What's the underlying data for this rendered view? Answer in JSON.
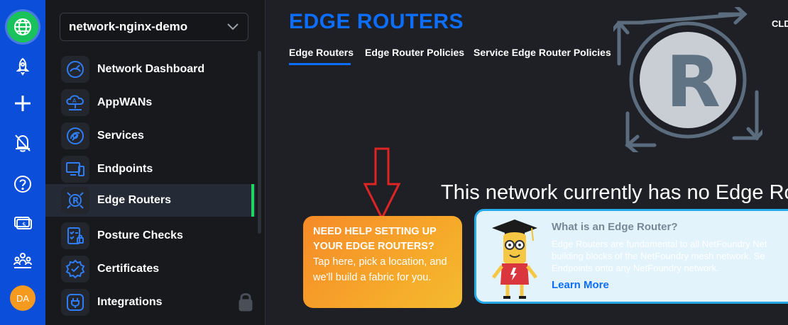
{
  "rail": {
    "avatar_initials": "DA",
    "icons": [
      "network-icon",
      "rocket-icon",
      "plus-icon",
      "alarm-bell-icon",
      "help-icon",
      "billing-icon",
      "organization-icon"
    ]
  },
  "sidebar": {
    "network_name": "network-nginx-demo",
    "items": [
      {
        "label": "Network Dashboard",
        "icon": "dashboard-gauge-icon"
      },
      {
        "label": "AppWANs",
        "icon": "appwan-cloud-icon"
      },
      {
        "label": "Services",
        "icon": "services-icon"
      },
      {
        "label": "Endpoints",
        "icon": "endpoints-icon"
      },
      {
        "label": "Edge Routers",
        "icon": "edge-router-icon",
        "active": true
      },
      {
        "label": "Posture Checks",
        "icon": "posture-checks-icon"
      },
      {
        "label": "Certificates",
        "icon": "certificates-icon"
      },
      {
        "label": "Integrations",
        "icon": "integrations-icon"
      }
    ]
  },
  "header": {
    "title": "EDGE ROUTERS",
    "user_code": "CLD",
    "tabs": [
      {
        "label": "Edge Routers",
        "active": true
      },
      {
        "label": "Edge Router Policies"
      },
      {
        "label": "Service Edge Router Policies"
      }
    ]
  },
  "empty_state": {
    "message": "This network currently has no Edge Ro",
    "logo_letter": "R"
  },
  "help_card": {
    "heading": "NEED HELP SETTING UP YOUR EDGE ROUTERS?",
    "body": "Tap here, pick a location, and we'll build a fabric for you."
  },
  "info_card": {
    "title": "What is an Edge Router?",
    "body": "Edge Routers are fundamental to all NetFoundry Net building blocks of the NetFoundry mesh network. Se Endpoints onto any NetFoundry network.",
    "link": "Learn More"
  },
  "colors": {
    "rail": "#0a4ed9",
    "accent": "#0d6efd",
    "active_indicator": "#1ed760",
    "help_card": "#f6a82a",
    "annotation_arrow": "#e02424"
  }
}
